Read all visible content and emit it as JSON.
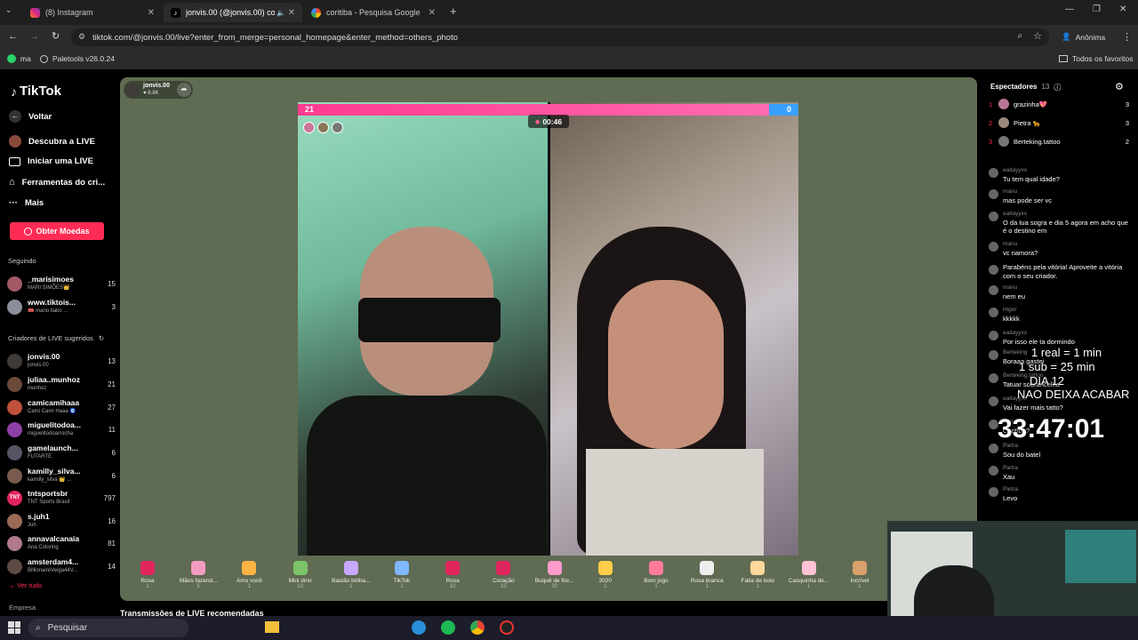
{
  "tabs": [
    {
      "title": "(8) Instagram",
      "active": false
    },
    {
      "title": "jonvis.00 (@jonvis.00) com",
      "active": true
    },
    {
      "title": "coritiba - Pesquisa Google",
      "active": false
    }
  ],
  "address": {
    "url": "tiktok.com/@jonvis.00/live?enter_from_merge=personal_homepage&enter_method=others_photo",
    "profile": "Anônima"
  },
  "bookmarks": {
    "items": [
      "ma",
      "Paletools v26.0.24"
    ],
    "all": "Todos os favoritos"
  },
  "sidebar": {
    "logo": "TikTok",
    "back": "Voltar",
    "nav": [
      "Descubra a LIVE",
      "Iniciar uma LIVE",
      "Ferramentas do cri...",
      "Mais"
    ],
    "coins_button": "Obter Moedas",
    "following_header": "Seguindo",
    "following": [
      {
        "name": "_marisimoes",
        "sub": "MARI SIMÕES👑",
        "count": "15"
      },
      {
        "name": "www.tiktois...",
        "sub": "🎟️ mano tiako ...",
        "count": "3"
      }
    ],
    "suggested_header": "Criadores de LIVE sugeridos",
    "suggested": [
      {
        "name": "jonvis.00",
        "sub": "jonvis.00",
        "count": "13"
      },
      {
        "name": "juliaa..munhoz",
        "sub": "munhoz",
        "count": "21"
      },
      {
        "name": "camicamihaaa",
        "sub": "Cami Cami Haaa 🧿",
        "count": "27"
      },
      {
        "name": "miguelitodoa...",
        "sub": "miguelitodoarrocha",
        "count": "11"
      },
      {
        "name": "gamelaunch...",
        "sub": "FUTARTE",
        "count": "6"
      },
      {
        "name": "kamilly_silva...",
        "sub": "kamilly_silva 👑 ...",
        "count": "6"
      },
      {
        "name": "tntsportsbr",
        "sub": "TNT Sports Brasil",
        "count": "797"
      },
      {
        "name": "s.juh1",
        "sub": "Juh",
        "count": "16"
      },
      {
        "name": "annavalcanaia",
        "sub": "Ana Coloring",
        "count": "81"
      },
      {
        "name": "amsterdam4...",
        "sub": "BillionaireVeiga44V...",
        "count": "14"
      }
    ],
    "see_all": "Ver tudo",
    "company": "Empresa"
  },
  "stream": {
    "host": "jonvis.00",
    "likes": "8.8K",
    "score_left": "21",
    "score_right": "0",
    "timer": "00:46",
    "recommended": "Transmissões de LIVE recomendadas"
  },
  "gifts": [
    {
      "name": "Rosa",
      "price": "1"
    },
    {
      "name": "Mãos fazend...",
      "price": "5"
    },
    {
      "name": "Amo você",
      "price": "1"
    },
    {
      "name": "Mini dino",
      "price": "10"
    },
    {
      "name": "Bastão brilha...",
      "price": "1"
    },
    {
      "name": "TikTok",
      "price": "1"
    },
    {
      "name": "Rosa",
      "price": "10"
    },
    {
      "name": "Coração",
      "price": "10"
    },
    {
      "name": "Buquê de flor...",
      "price": "30"
    },
    {
      "name": "2020",
      "price": "1"
    },
    {
      "name": "Bom jogo",
      "price": "1"
    },
    {
      "name": "Rosa branca",
      "price": "1"
    },
    {
      "name": "Fatia de bolo",
      "price": "1"
    },
    {
      "name": "Casquinha de...",
      "price": "1"
    },
    {
      "name": "Incrível",
      "price": "1"
    }
  ],
  "viewers": {
    "header": "Espectadores",
    "count": "13",
    "top": [
      {
        "rank": "1",
        "name": "grazinha💖",
        "score": "3"
      },
      {
        "rank": "2",
        "name": "Pietra 🐆",
        "score": "3"
      },
      {
        "rank": "3",
        "name": "Berteking.tattoo",
        "score": "2"
      }
    ]
  },
  "chat": [
    {
      "who": "eaitayyxx",
      "msg": "Tu tem qual idade?"
    },
    {
      "who": "manu",
      "msg": "mas pode ser vc"
    },
    {
      "who": "eaitayyxx",
      "msg": "O da tua sogra e dia 5 agora em acho que é o destino em"
    },
    {
      "who": "manu",
      "msg": "vc namora?"
    },
    {
      "who": "",
      "msg": "Parabéns pela vitória! Aproveite a vitória com o seu criador."
    },
    {
      "who": "manu",
      "msg": "nem eu"
    },
    {
      "who": "Higor",
      "msg": "kkkkk"
    },
    {
      "who": "eaitayyxx",
      "msg": "Por isso ele ta dormindo"
    },
    {
      "who": "Berteking",
      "msg": "Boraaa gastei"
    },
    {
      "who": "Berteking.tattoo",
      "msg": "Tatuar sobrancelha"
    },
    {
      "who": "eaitayyxx",
      "msg": "Vai fazer mais tatto?"
    },
    {
      "who": "Pietra",
      "msg": "Curitiba?"
    },
    {
      "who": "Pietra",
      "msg": "Sou do batel"
    },
    {
      "who": "Pietra",
      "msg": "Xau"
    },
    {
      "who": "Pietra",
      "msg": "Levo"
    }
  ],
  "overlay": {
    "line1": "1 real = 1 min",
    "line2": "1 sub = 25 min",
    "line3": "DIA 12",
    "line4": "NAO DEIXA ACABAR",
    "timer": "33:47:01"
  },
  "taskbar": {
    "search": "Pesquisar"
  },
  "colors": {
    "accent": "#fe2c55",
    "stage": "#5f6b52",
    "score_bar": "#ff3b8f",
    "blue_score": "#3aa0ff"
  }
}
